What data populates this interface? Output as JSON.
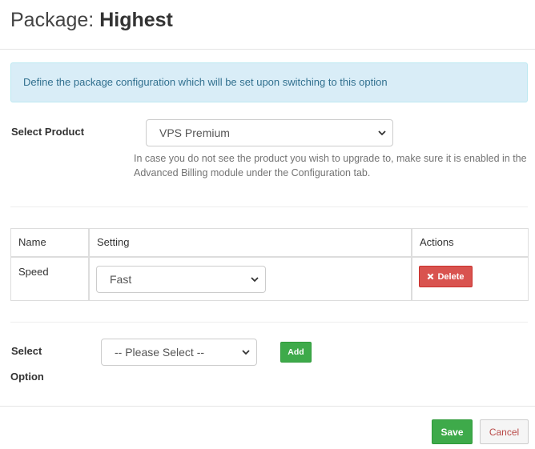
{
  "header": {
    "title_prefix": "Package:",
    "title_name": "Highest"
  },
  "alert": {
    "text": "Define the package configuration which will be set upon switching to this option"
  },
  "product": {
    "label": "Select Product",
    "selected": "VPS Premium",
    "help": "In case you do not see the product you wish to upgrade to, make sure it is enabled in the Advanced Billing module under the Configuration tab."
  },
  "table": {
    "columns": [
      "Name",
      "Setting",
      "Actions"
    ],
    "rows": [
      {
        "name": "Speed",
        "setting": "Fast",
        "action": "Delete"
      }
    ]
  },
  "option": {
    "label_line1": "Select",
    "label_line2": "Option",
    "selected": "-- Please Select --",
    "add_label": "Add"
  },
  "footer": {
    "save_label": "Save",
    "cancel_label": "Cancel"
  },
  "icons": {
    "delete": "times-icon",
    "dropdown": "chevron-down-icon"
  },
  "colors": {
    "info_bg": "#d9edf7",
    "info_text": "#31708f",
    "danger": "#d9534f",
    "success": "#3eaa4a",
    "cancel_text": "#b94a48"
  }
}
